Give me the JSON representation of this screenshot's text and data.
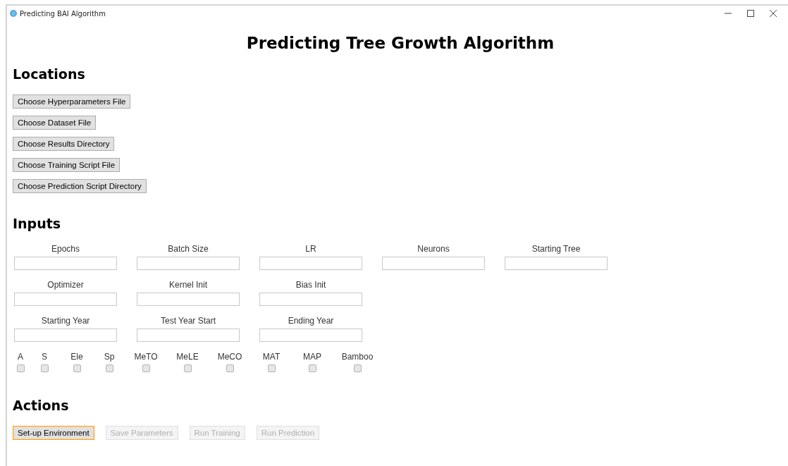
{
  "window": {
    "title": "Predicting BAI Algorithm"
  },
  "heading": "Predicting Tree Growth Algorithm",
  "locations": {
    "title": "Locations",
    "buttons": [
      {
        "label": "Choose Hyperparameters File"
      },
      {
        "label": "Choose Dataset File"
      },
      {
        "label": "Choose Results Directory"
      },
      {
        "label": "Choose Training Script File"
      },
      {
        "label": "Choose Prediction Script Directory"
      }
    ]
  },
  "inputs": {
    "title": "Inputs",
    "rows": [
      [
        {
          "label": "Epochs"
        },
        {
          "label": "Batch Size"
        },
        {
          "label": "LR"
        },
        {
          "label": "Neurons"
        },
        {
          "label": "Starting Tree"
        }
      ],
      [
        {
          "label": "Optimizer"
        },
        {
          "label": "Kernel Init"
        },
        {
          "label": "Bias Init"
        }
      ],
      [
        {
          "label": "Starting Year"
        },
        {
          "label": "Test Year Start"
        },
        {
          "label": "Ending Year"
        }
      ]
    ],
    "checkboxes": [
      {
        "label": "A",
        "checked": false
      },
      {
        "label": "S",
        "checked": false
      },
      {
        "label": "Ele",
        "checked": false
      },
      {
        "label": "Sp",
        "checked": false
      },
      {
        "label": "MeTO",
        "checked": false
      },
      {
        "label": "MeLE",
        "checked": false
      },
      {
        "label": "MeCO",
        "checked": false
      },
      {
        "label": "MAT",
        "checked": false
      },
      {
        "label": "MAP",
        "checked": false
      },
      {
        "label": "Bamboo",
        "checked": false
      }
    ]
  },
  "actions": {
    "title": "Actions",
    "buttons": [
      {
        "label": "Set-up Environment",
        "focused": true,
        "disabled": false
      },
      {
        "label": "Save Parameters",
        "focused": false,
        "disabled": true
      },
      {
        "label": "Run Training",
        "focused": false,
        "disabled": true
      },
      {
        "label": "Run Prediction",
        "focused": false,
        "disabled": true
      }
    ]
  }
}
